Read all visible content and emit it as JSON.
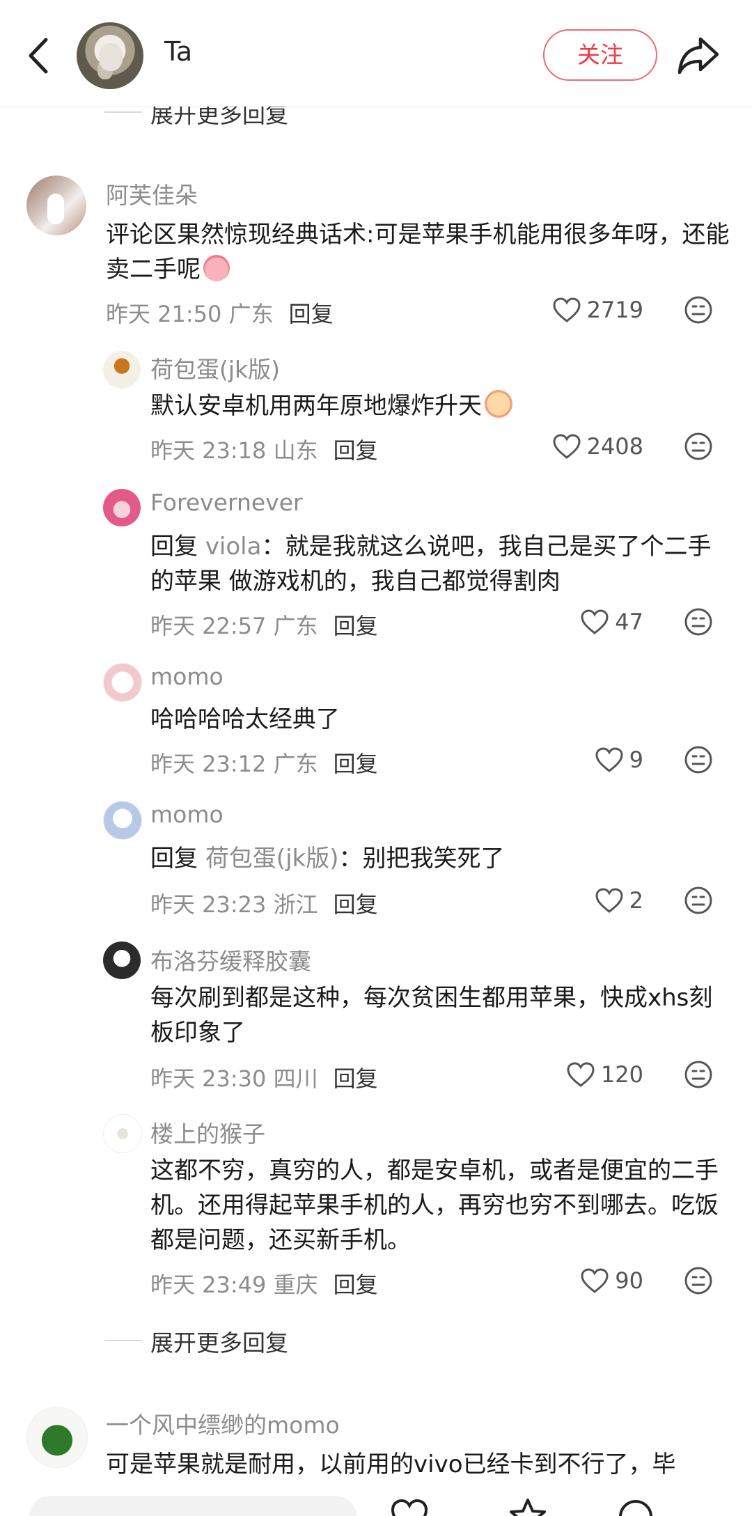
{
  "header": {
    "user_name": "Ta",
    "follow_label": "关注"
  },
  "top_expand": "展开更多回复",
  "bottom_expand": "展开更多回复",
  "main_comment": {
    "user": "阿芙佳朵",
    "text": "评论区果然惊现经典话术:可是苹果手机能用很多年呀，还能卖二手呢",
    "emoji": "pig-face-emoji",
    "time_location": "昨天 21:50 广东",
    "reply_label": "回复",
    "likes": "2719"
  },
  "replies": [
    {
      "user": "荷包蛋(jk版)",
      "text": "默认安卓机用两年原地爆炸升天",
      "emoji": "crying-face-emoji",
      "time_location": "昨天 23:18 山东",
      "reply_label": "回复",
      "likes": "2408"
    },
    {
      "user": "Forevernever",
      "reply_prefix": "回复",
      "reply_to": "viola",
      "text": "：就是我就这么说吧，我自己是买了个二手的苹果 做游戏机的，我自己都觉得割肉",
      "time_location": "昨天 22:57 广东",
      "reply_label": "回复",
      "likes": "47"
    },
    {
      "user": "momo",
      "text": "哈哈哈哈太经典了",
      "time_location": "昨天 23:12 广东",
      "reply_label": "回复",
      "likes": "9"
    },
    {
      "user": "momo",
      "reply_prefix": "回复",
      "reply_to": "荷包蛋(jk版)",
      "text": "：别把我笑死了",
      "time_location": "昨天 23:23 浙江",
      "reply_label": "回复",
      "likes": "2"
    },
    {
      "user": "布洛芬缓释胶囊",
      "text": "每次刷到都是这种，每次贫困生都用苹果，快成xhs刻板印象了",
      "time_location": "昨天 23:30 四川",
      "reply_label": "回复",
      "likes": "120"
    },
    {
      "user": "楼上的猴子",
      "text": "这都不穷，真穷的人，都是安卓机，或者是便宜的二手机。还用得起苹果手机的人，再穷也穷不到哪去。吃饭都是问题，还买新手机。",
      "time_location": "昨天 23:49 重庆",
      "reply_label": "回复",
      "likes": "90"
    }
  ],
  "next_comment": {
    "user": "一个风中缥缈的momo",
    "text": "可是苹果就是耐用，以前用的vivo已经卡到不行了，毕"
  },
  "colors": {
    "accent_red": "#ee3a46",
    "username_gray": "#8c8c8c",
    "text_dark": "#1a1a1a"
  }
}
